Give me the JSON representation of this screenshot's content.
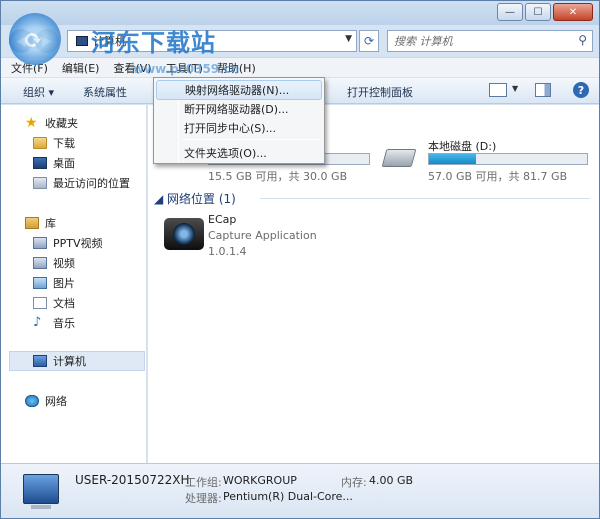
{
  "window": {
    "title_text": "计算机",
    "controls": {
      "minimize": "—",
      "maximize": "☐",
      "close": "✕"
    }
  },
  "address": {
    "path": "计算机",
    "search_placeholder": "搜索 计算机"
  },
  "menubar": {
    "items": [
      "文件(F)",
      "编辑(E)",
      "查看(V)",
      "工具(T)",
      "帮助(H)"
    ]
  },
  "toolbar": {
    "organize": "组织 ▾",
    "system_properties": "系统属性",
    "open_control_panel": "打开控制面板",
    "help": "?"
  },
  "context_menu": {
    "items": [
      "映射网络驱动器(N)...",
      "断开网络驱动器(D)...",
      "打开同步中心(S)...",
      "文件夹选项(O)..."
    ]
  },
  "navpane": {
    "favorites": {
      "label": "收藏夹",
      "items": [
        "下载",
        "桌面",
        "最近访问的位置"
      ]
    },
    "libraries": {
      "label": "库",
      "items": [
        "PPTV视频",
        "视频",
        "图片",
        "文档",
        "音乐"
      ]
    },
    "computer": "计算机",
    "network": "网络"
  },
  "content": {
    "drives": [
      {
        "label": "",
        "free_text": "15.5 GB 可用，共 30.0 GB",
        "used_fraction": 0.48
      },
      {
        "label": "本地磁盘 (D:)",
        "free_text": "57.0 GB 可用，共 81.7 GB",
        "used_fraction": 0.3
      }
    ],
    "network_section": "网络位置 (1)",
    "network_items": [
      {
        "name": "ECap",
        "description": "Capture Application",
        "version": "1.0.1.4"
      }
    ]
  },
  "details": {
    "computer_name": "USER-20150722XH",
    "workgroup_label": "工作组:",
    "workgroup_value": "WORKGROUP",
    "memory_label": "内存:",
    "memory_value": "4.00 GB",
    "processor_label": "处理器:",
    "processor_value": "Pentium(R) Dual-Core..."
  },
  "watermark": {
    "title": "河东下载站",
    "url": "www.pc0359.cn"
  },
  "colors": {
    "accent": "#2f68b4",
    "drive_fill": "#168ac7",
    "section_head": "#1e3f7a"
  }
}
